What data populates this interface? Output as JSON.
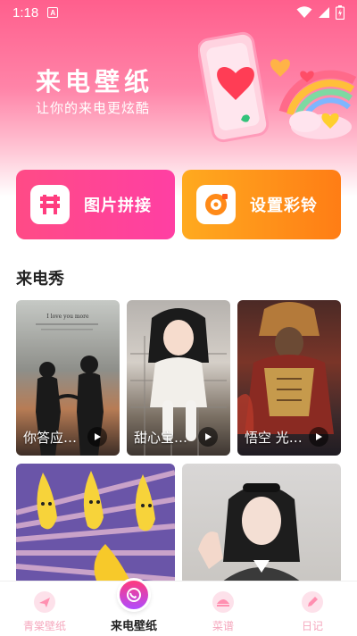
{
  "status_bar": {
    "time": "1:18",
    "notification_badge": "A"
  },
  "hero": {
    "title": "来电壁纸",
    "subtitle": "让你的来电更炫酷"
  },
  "features": [
    {
      "label": "图片拼接",
      "icon": "image-collage-icon"
    },
    {
      "label": "设置彩铃",
      "icon": "ringtone-disc-icon"
    }
  ],
  "section": {
    "title": "来电秀"
  },
  "cards": [
    {
      "caption": "你答应…",
      "icon": "play-icon"
    },
    {
      "caption": "甜心宝…",
      "icon": "play-icon"
    },
    {
      "caption": "悟空 光…",
      "icon": "play-icon"
    }
  ],
  "card1_overlay": "I love you more",
  "tabs": [
    {
      "label": "青棠壁纸",
      "active": false
    },
    {
      "label": "来电壁纸",
      "active": true
    },
    {
      "label": "菜谱",
      "active": false
    },
    {
      "label": "日记",
      "active": false
    }
  ],
  "colors": {
    "accent_pink": "#ff4b86",
    "accent_orange": "#ff8a18",
    "tab_inactive": "#f5a7bd"
  }
}
